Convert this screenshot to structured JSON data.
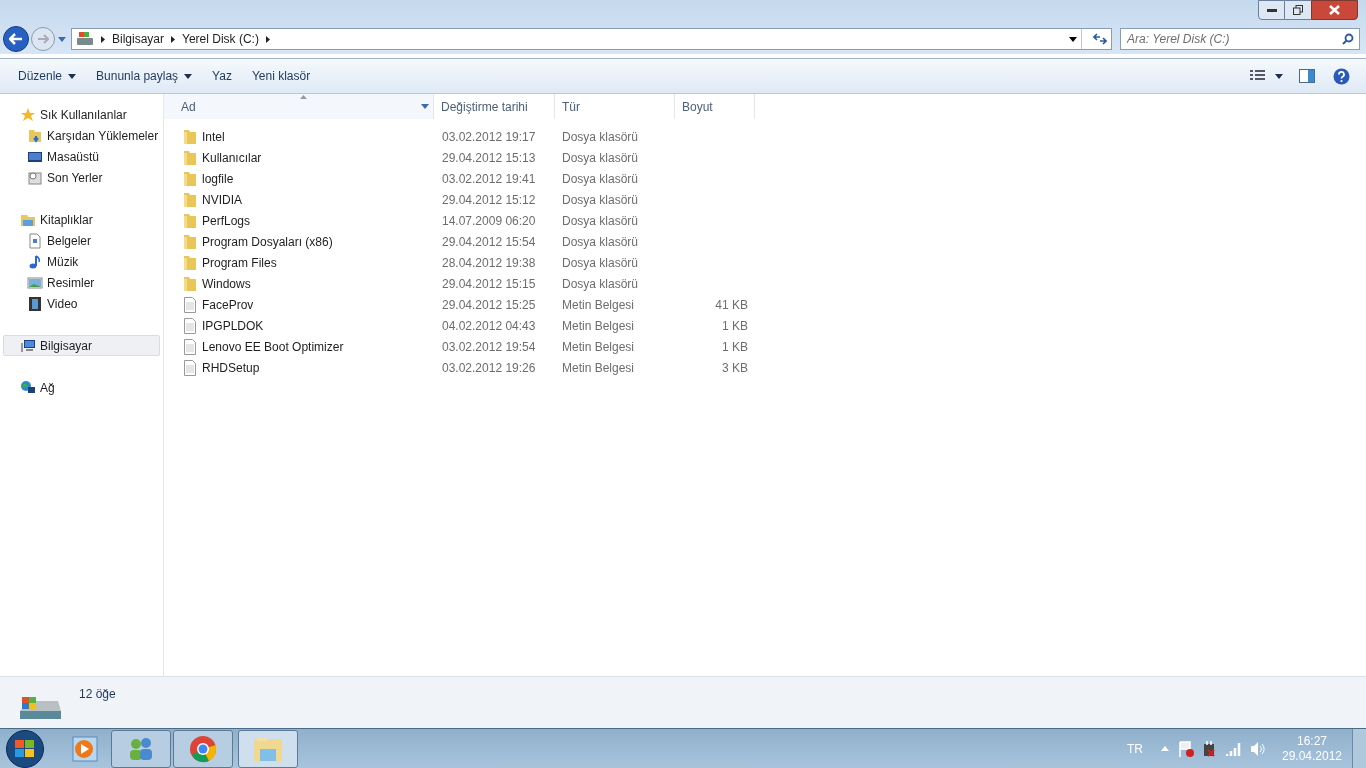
{
  "address": {
    "crumbs": [
      "Bilgisayar",
      "Yerel Disk (C:)"
    ]
  },
  "search": {
    "placeholder": "Ara: Yerel Disk (C:)"
  },
  "toolbar": [
    {
      "label": "Düzenle",
      "dropdown": true
    },
    {
      "label": "Bununla paylaş",
      "dropdown": true
    },
    {
      "label": "Yaz",
      "dropdown": false
    },
    {
      "label": "Yeni klasör",
      "dropdown": false
    }
  ],
  "sidebar": [
    {
      "label": "Sık Kullanılanlar",
      "kind": "star",
      "selected": false,
      "children": [
        {
          "label": "Karşıdan Yüklemeler",
          "kind": "download",
          "selected": false
        },
        {
          "label": "Masaüstü",
          "kind": "desktop",
          "selected": false
        },
        {
          "label": "Son Yerler",
          "kind": "recent",
          "selected": false
        }
      ]
    },
    {
      "label": "Kitaplıklar",
      "kind": "library",
      "selected": false,
      "children": [
        {
          "label": "Belgeler",
          "kind": "document",
          "selected": false
        },
        {
          "label": "Müzik",
          "kind": "music",
          "selected": false
        },
        {
          "label": "Resimler",
          "kind": "picture",
          "selected": false
        },
        {
          "label": "Video",
          "kind": "video",
          "selected": false
        }
      ]
    },
    {
      "label": "Bilgisayar",
      "kind": "computer",
      "selected": true
    },
    {
      "label": "Ağ",
      "kind": "network",
      "selected": false
    }
  ],
  "table": {
    "columns": [
      "Ad",
      "Değiştirme tarihi",
      "Tür",
      "Boyut"
    ],
    "rows": [
      {
        "kind": "folder",
        "name": "Intel",
        "date": "03.02.2012 19:17",
        "type": "Dosya klasörü"
      },
      {
        "kind": "folder",
        "name": "Kullanıcılar",
        "date": "29.04.2012 15:13",
        "type": "Dosya klasörü"
      },
      {
        "kind": "folder",
        "name": "logfile",
        "date": "03.02.2012 19:41",
        "type": "Dosya klasörü"
      },
      {
        "kind": "folder",
        "name": "NVIDIA",
        "date": "29.04.2012 15:12",
        "type": "Dosya klasörü"
      },
      {
        "kind": "folder",
        "name": "PerfLogs",
        "date": "14.07.2009 06:20",
        "type": "Dosya klasörü"
      },
      {
        "kind": "folder",
        "name": "Program Dosyaları (x86)",
        "date": "29.04.2012 15:54",
        "type": "Dosya klasörü"
      },
      {
        "kind": "folder",
        "name": "Program Files",
        "date": "28.04.2012 19:38",
        "type": "Dosya klasörü"
      },
      {
        "kind": "folder",
        "name": "Windows",
        "date": "29.04.2012 15:15",
        "type": "Dosya klasörü"
      },
      {
        "kind": "file",
        "name": "FaceProv",
        "date": "29.04.2012 15:25",
        "type": "Metin Belgesi",
        "size": "41 KB"
      },
      {
        "kind": "file",
        "name": "IPGPLDOK",
        "date": "04.02.2012 04:43",
        "type": "Metin Belgesi",
        "size": "1 KB"
      },
      {
        "kind": "file",
        "name": "Lenovo EE Boot Optimizer",
        "date": "03.02.2012 19:54",
        "type": "Metin Belgesi",
        "size": "1 KB"
      },
      {
        "kind": "file",
        "name": "RHDSetup",
        "date": "03.02.2012 19:26",
        "type": "Metin Belgesi",
        "size": "3 KB"
      }
    ]
  },
  "status_bar": {
    "text": "12 öğe"
  },
  "tray": {
    "language": "TR",
    "time": "16:27",
    "date": "29.04.2012"
  }
}
